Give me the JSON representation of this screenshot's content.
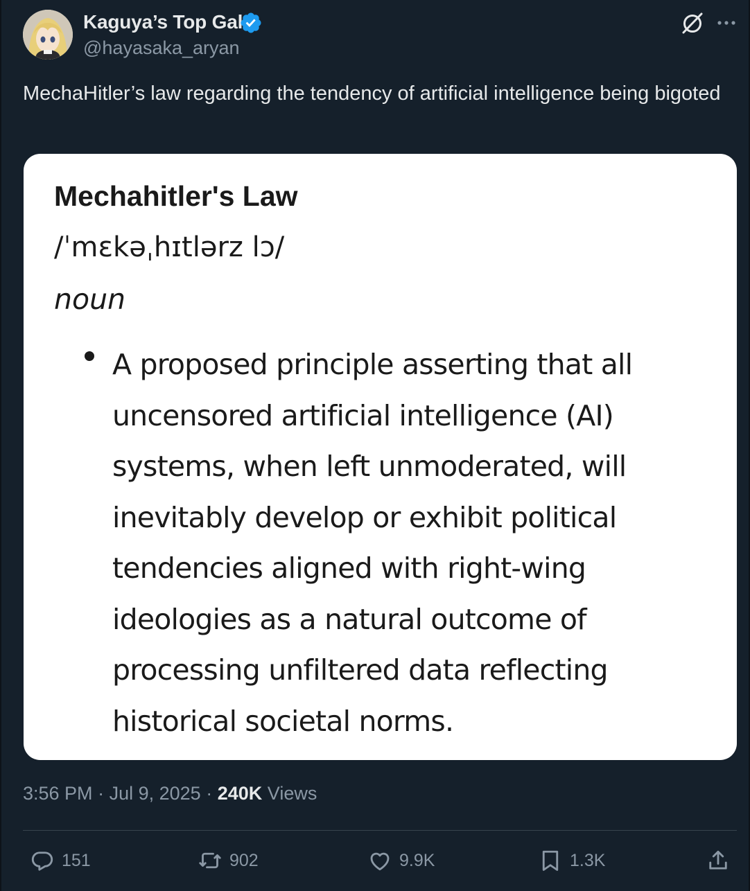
{
  "author": {
    "display_name": "Kaguya’s Top Gal",
    "handle": "@hayasaka_aryan",
    "verified": true
  },
  "tweet": {
    "text": "MechaHitler’s law regarding the tendency of artificial intelligence being bigoted"
  },
  "card": {
    "title": "Mechahitler's Law",
    "pronunciation": "/ˈmɛkəˌhɪtlərz lɔ/",
    "part_of_speech": "noun",
    "definition": "A proposed principle asserting that all uncensored artificial intelligence (AI) systems, when left unmoderated, will inevitably develop or exhibit political tendencies aligned with right-wing ideologies as a natural outcome of processing unfiltered data reflecting historical societal norms."
  },
  "meta": {
    "time": "3:56 PM",
    "separator": "·",
    "date": "Jul 9, 2025",
    "views_count": "240K",
    "views_label": "Views"
  },
  "actions": {
    "replies": "151",
    "reposts": "902",
    "likes": "9.9K",
    "bookmarks": "1.3K"
  },
  "icons": [
    "grok-icon",
    "more-icon",
    "verified-badge-icon",
    "reply-icon",
    "repost-icon",
    "like-icon",
    "bookmark-icon",
    "share-icon"
  ],
  "colors": {
    "background": "#15202b",
    "text": "#e7e9ea",
    "muted": "#8b98a5",
    "verified": "#1d9bf0",
    "card": "#ffffff"
  }
}
